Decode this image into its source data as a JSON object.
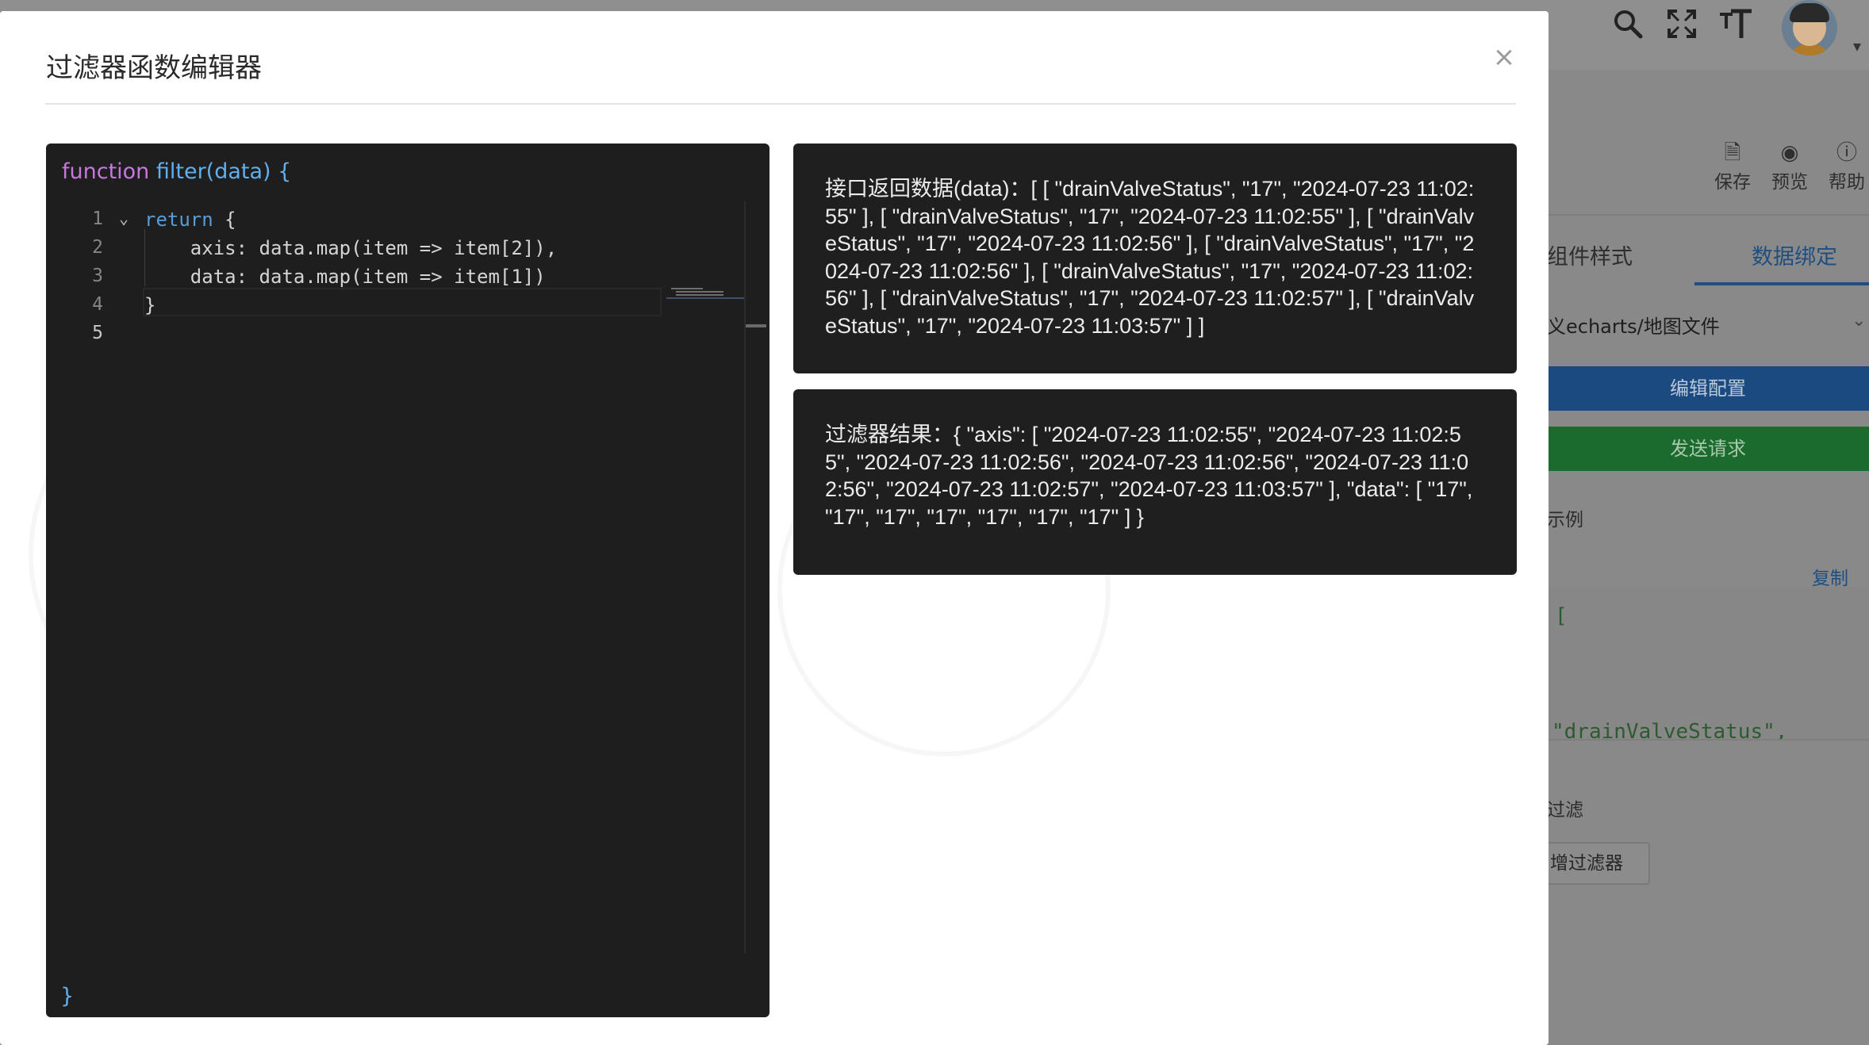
{
  "background": {
    "top_icons": {
      "search": "search-icon",
      "fullscreen": "fullscreen-icon",
      "font_size": "font-size-icon",
      "avatar": "user-avatar"
    },
    "toolbar": {
      "save_label": "保存",
      "preview_label": "预览",
      "help_label": "帮助"
    },
    "tabs": {
      "component_style": "组件样式",
      "data_binding": "数据绑定"
    },
    "source_select_value": "义echarts/地图文件",
    "edit_config_label": "编辑配置",
    "send_request_label": "发送请求",
    "example_label": "示例",
    "copy_label": "复制",
    "code_preview": {
      "line1": "[",
      "line2": "\"drainValveStatus\","
    },
    "filter_label": "过滤",
    "add_filter_label": "增过滤器"
  },
  "modal": {
    "title": "过滤器函数编辑器",
    "close_glyph": "×",
    "editor": {
      "header_keyword": "function",
      "header_rest": " filter(data) {",
      "footer": "}",
      "lines": [
        {
          "num": "1",
          "keyword": "return",
          "text": " {"
        },
        {
          "num": "2",
          "text": "    axis: data.map(item => item[2]),"
        },
        {
          "num": "3",
          "text": "    data: data.map(item => item[1])"
        },
        {
          "num": "4",
          "text": "}"
        },
        {
          "num": "5",
          "text": ""
        }
      ]
    },
    "api_data_text": "接口返回数据(data)：[ [ \"drainValveStatus\", \"17\", \"2024-07-23 11:02:55\" ], [ \"drainValveStatus\", \"17\", \"2024-07-23 11:02:55\" ], [ \"drainValveStatus\", \"17\", \"2024-07-23 11:02:56\" ], [ \"drainValveStatus\", \"17\", \"2024-07-23 11:02:56\" ], [ \"drainValveStatus\", \"17\", \"2024-07-23 11:02:56\" ], [ \"drainValveStatus\", \"17\", \"2024-07-23 11:02:57\" ], [ \"drainValveStatus\", \"17\", \"2024-07-23 11:03:57\" ] ]",
    "filter_result_text": "过滤器结果：{ \"axis\": [ \"2024-07-23 11:02:55\", \"2024-07-23 11:02:55\", \"2024-07-23 11:02:56\", \"2024-07-23 11:02:56\", \"2024-07-23 11:02:56\", \"2024-07-23 11:02:57\", \"2024-07-23 11:03:57\" ], \"data\": [ \"17\", \"17\", \"17\", \"17\", \"17\", \"17\", \"17\" ] }"
  }
}
